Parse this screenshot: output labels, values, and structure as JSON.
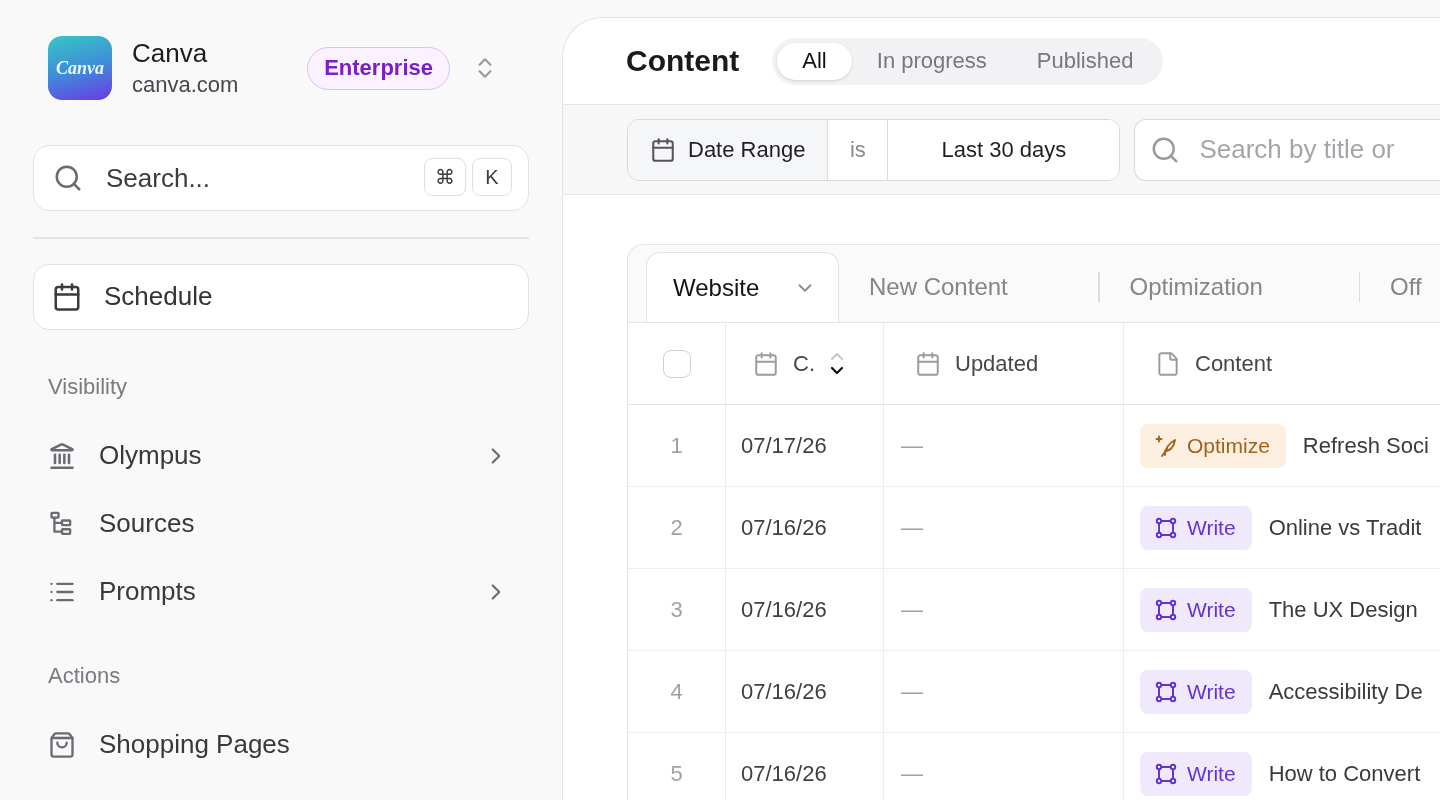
{
  "sidebar": {
    "workspace": {
      "logo_text": "Canva",
      "name": "Canva",
      "domain": "canva.com",
      "plan": "Enterprise"
    },
    "search": {
      "placeholder": "Search...",
      "shortcut": [
        "⌘",
        "K"
      ]
    },
    "schedule_button": {
      "label": "Schedule"
    },
    "sections": [
      {
        "title": "Visibility",
        "items": [
          {
            "label": "Olympus",
            "has_submenu": true
          },
          {
            "label": "Sources",
            "has_submenu": false
          },
          {
            "label": "Prompts",
            "has_submenu": true
          }
        ]
      },
      {
        "title": "Actions",
        "items": [
          {
            "label": "Shopping Pages",
            "has_submenu": false
          }
        ]
      }
    ]
  },
  "main": {
    "title": "Content",
    "status_tabs": [
      {
        "label": "All",
        "selected": true
      },
      {
        "label": "In progress",
        "selected": false
      },
      {
        "label": "Published",
        "selected": false
      }
    ],
    "filter": {
      "field": "Date Range",
      "operator": "is",
      "value": "Last 30 days"
    },
    "search": {
      "placeholder": "Search by title or"
    },
    "table": {
      "tabs": [
        {
          "label": "Website",
          "selected": true
        },
        {
          "label": "New Content",
          "selected": false
        },
        {
          "label": "Optimization",
          "selected": false
        },
        {
          "label": "Off",
          "selected": false
        }
      ],
      "select_all": {
        "checked": false
      },
      "columns": [
        {
          "label": "C.",
          "sorted": true,
          "descending": true
        },
        {
          "label": "Updated",
          "sorted": false
        },
        {
          "label": "Content",
          "sorted": false
        }
      ],
      "rows": [
        {
          "number": "1",
          "created": "07/17/26",
          "updated": "—",
          "tag": {
            "kind": "optimize",
            "label": "Optimize"
          },
          "title": "Refresh Soci"
        },
        {
          "number": "2",
          "created": "07/16/26",
          "updated": "—",
          "tag": {
            "kind": "write",
            "label": "Write"
          },
          "title": "Online vs Tradit"
        },
        {
          "number": "3",
          "created": "07/16/26",
          "updated": "—",
          "tag": {
            "kind": "write",
            "label": "Write"
          },
          "title": "The UX Design"
        },
        {
          "number": "4",
          "created": "07/16/26",
          "updated": "—",
          "tag": {
            "kind": "write",
            "label": "Write"
          },
          "title": "Accessibility De"
        },
        {
          "number": "5",
          "created": "07/16/26",
          "updated": "—",
          "tag": {
            "kind": "write",
            "label": "Write"
          },
          "title": "How to Convert"
        }
      ]
    }
  }
}
